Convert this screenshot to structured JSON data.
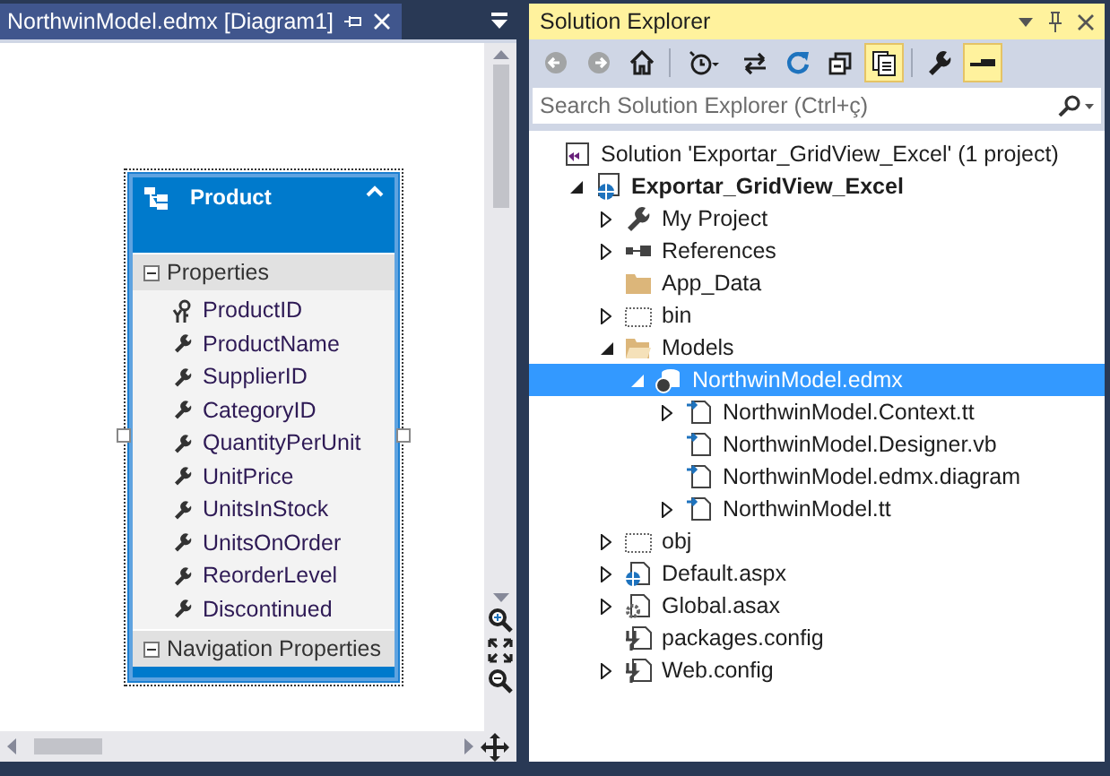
{
  "editor": {
    "tab": {
      "title": "NorthwinModel.edmx [Diagram1]",
      "selected": true
    },
    "entity": {
      "title": "Product",
      "sections": [
        {
          "title": "Properties",
          "expanded": true,
          "items": [
            {
              "name": "ProductID",
              "kind": "key"
            },
            {
              "name": "ProductName",
              "kind": "property"
            },
            {
              "name": "SupplierID",
              "kind": "property"
            },
            {
              "name": "CategoryID",
              "kind": "property"
            },
            {
              "name": "QuantityPerUnit",
              "kind": "property"
            },
            {
              "name": "UnitPrice",
              "kind": "property"
            },
            {
              "name": "UnitsInStock",
              "kind": "property"
            },
            {
              "name": "UnitsOnOrder",
              "kind": "property"
            },
            {
              "name": "ReorderLevel",
              "kind": "property"
            },
            {
              "name": "Discontinued",
              "kind": "property"
            }
          ]
        },
        {
          "title": "Navigation Properties",
          "expanded": true
        }
      ]
    }
  },
  "solution_explorer": {
    "title": "Solution Explorer",
    "toolbar": [
      {
        "kind": "back",
        "disabled": true,
        "selected": false
      },
      {
        "kind": "forward",
        "disabled": true,
        "selected": false
      },
      {
        "kind": "home",
        "disabled": false,
        "selected": false
      },
      {
        "kind": "history",
        "disabled": false,
        "selected": false
      },
      {
        "kind": "sync",
        "disabled": false,
        "selected": false
      },
      {
        "kind": "refresh",
        "disabled": false,
        "selected": false
      },
      {
        "kind": "collapse",
        "disabled": false,
        "selected": false
      },
      {
        "kind": "show-all",
        "disabled": false,
        "selected": true
      },
      {
        "kind": "properties",
        "disabled": false,
        "selected": false
      },
      {
        "kind": "preview",
        "disabled": false,
        "selected": true
      }
    ],
    "search": {
      "placeholder": "Search Solution Explorer (Ctrl+ç)"
    },
    "tree": [
      {
        "label": "Solution 'Exportar_GridView_Excel' (1 project)",
        "kind": "solution",
        "selected": false,
        "children": [
          {
            "label": "Exportar_GridView_Excel",
            "kind": "web-project",
            "expanded": true,
            "selected": false,
            "bold": true,
            "children": [
              {
                "label": "My Project",
                "kind": "wrench",
                "expanded": false,
                "selected": false
              },
              {
                "label": "References",
                "kind": "references",
                "expanded": false,
                "selected": false
              },
              {
                "label": "App_Data",
                "kind": "folder",
                "selected": false
              },
              {
                "label": "bin",
                "kind": "hidden-folder",
                "expanded": false,
                "selected": false
              },
              {
                "label": "Models",
                "kind": "open-folder",
                "expanded": true,
                "selected": false,
                "children": [
                  {
                    "label": "NorthwinModel.edmx",
                    "kind": "edmx",
                    "expanded": true,
                    "selected": true,
                    "children": [
                      {
                        "label": "NorthwinModel.Context.tt",
                        "kind": "generated-file",
                        "expanded": false,
                        "selected": false
                      },
                      {
                        "label": "NorthwinModel.Designer.vb",
                        "kind": "generated-file",
                        "selected": false
                      },
                      {
                        "label": "NorthwinModel.edmx.diagram",
                        "kind": "generated-file",
                        "selected": false
                      },
                      {
                        "label": "NorthwinModel.tt",
                        "kind": "generated-file",
                        "expanded": false,
                        "selected": false
                      }
                    ]
                  }
                ]
              },
              {
                "label": "obj",
                "kind": "hidden-folder",
                "expanded": false,
                "selected": false
              },
              {
                "label": "Default.aspx",
                "kind": "web-file",
                "expanded": false,
                "selected": false
              },
              {
                "label": "Global.asax",
                "kind": "gear-file",
                "expanded": false,
                "selected": false
              },
              {
                "label": "packages.config",
                "kind": "config-file",
                "selected": false
              },
              {
                "label": "Web.config",
                "kind": "config-file",
                "expanded": false,
                "selected": false
              }
            ]
          }
        ]
      }
    ]
  }
}
